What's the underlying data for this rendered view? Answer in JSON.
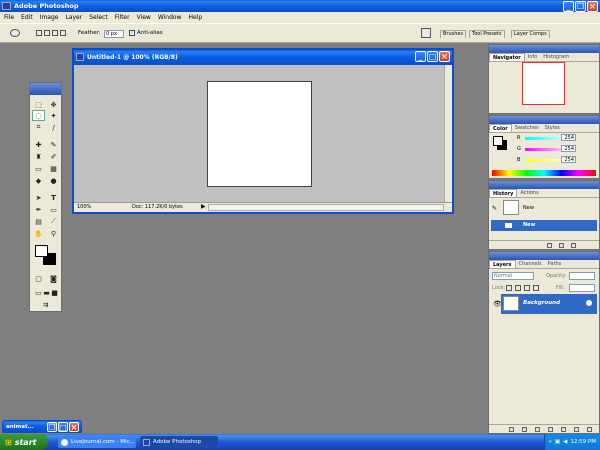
{
  "app": {
    "title": "Adobe Photoshop"
  },
  "menu": [
    "File",
    "Edit",
    "Image",
    "Layer",
    "Select",
    "Filter",
    "View",
    "Window",
    "Help"
  ],
  "options": {
    "feather_label": "Feather:",
    "feather_value": "0 px",
    "antialias_label": "Anti-alias",
    "well_tabs": [
      "Brushes",
      "Tool Presets",
      "Layer Comps"
    ]
  },
  "document": {
    "title": "Untitled-1 @ 100% (RGB/8)",
    "zoom": "100%",
    "doc_info": "Doc: 117.2K/0 bytes"
  },
  "navigator": {
    "tabs": [
      "Navigator",
      "Info",
      "Histogram"
    ]
  },
  "color_panel": {
    "tabs": [
      "Color",
      "Swatches",
      "Styles"
    ],
    "r_label": "R",
    "g_label": "G",
    "b_label": "B",
    "r": "254",
    "g": "254",
    "b": "254"
  },
  "history": {
    "tabs": [
      "History",
      "Actions"
    ],
    "snapshot": "New",
    "step": "New"
  },
  "layers": {
    "tabs": [
      "Layers",
      "Channels",
      "Paths"
    ],
    "blend_mode": "Normal",
    "opacity_label": "Opacity:",
    "lock_label": "Lock:",
    "fill_label": "Fill:",
    "layer_name": "Background"
  },
  "minimized": {
    "title": "animat..."
  },
  "taskbar": {
    "start": "start",
    "items": [
      "LiveJournal.com - Mic...",
      "Adobe Photoshop"
    ],
    "clock": "12:59 PM"
  },
  "colors": {
    "workspace": "#7f7f7f",
    "xp_blue": "#0a4fc7",
    "selection": "#316ac5",
    "start_green": "#2c8a2c"
  }
}
